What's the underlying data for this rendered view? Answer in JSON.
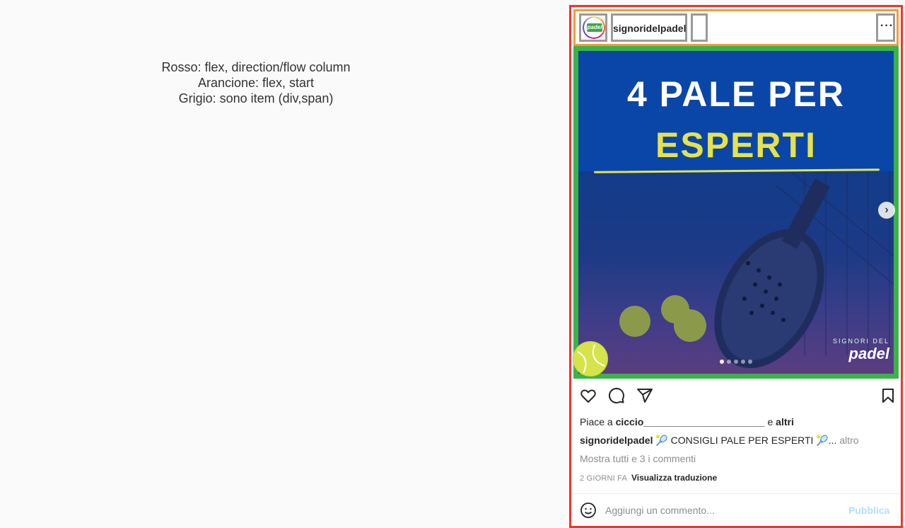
{
  "legend": {
    "line1": "Rosso: flex, direction/flow column",
    "line2": "Arancione: flex, start",
    "line3": "Grigio: sono item (div,span)"
  },
  "post": {
    "username": "signoridelpadel",
    "avatar_text": "padel",
    "more_label": "···",
    "media": {
      "title_line1": "4 PALE PER",
      "title_line2": "ESPERTI",
      "brand_small": "SIGNORI DEL",
      "brand_big": "padel",
      "carousel_total": 5,
      "carousel_active_index": 0
    },
    "likes": {
      "prefix": "Piace a ",
      "user": "ciccio______________________",
      "middle": " e ",
      "others": "altri"
    },
    "caption": {
      "user": "signoridelpadel",
      "text": " 🎾 CONSIGLI PALE PER ESPERTI 🎾...",
      "more": " altro"
    },
    "comments_link": "Mostra tutti e 3 i commenti",
    "time": "2 GIORNI FA",
    "translate": "Visualizza traduzione",
    "comment_placeholder": "Aggiungi un commento...",
    "publish_label": "Pubblica"
  },
  "colors": {
    "flex_column_border": "#f0352c",
    "flex_start_border": "#f59b3a",
    "item_border": "#9a9a9a",
    "media_border": "#3ab34a",
    "media_blue": "#0a46a8",
    "title_yellow": "#e6e34a",
    "publish_disabled": "#b2dffc"
  },
  "icons": [
    "heart-icon",
    "comment-icon",
    "share-icon",
    "bookmark-icon",
    "smiley-icon",
    "chevron-right-icon",
    "more-icon"
  ]
}
